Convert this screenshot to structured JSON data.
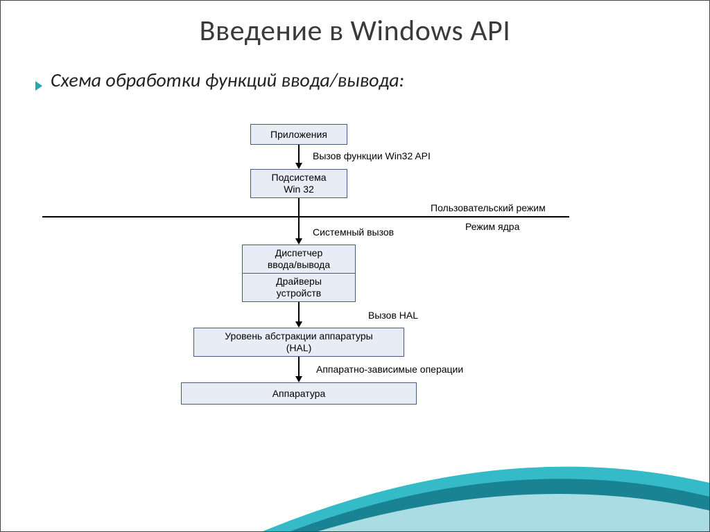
{
  "title": "Введение в Windows API",
  "subtitle": "Схема обработки функций ввода/вывода:",
  "boxes": {
    "apps": "Приложения",
    "win32": "Подсистема\nWin 32",
    "iomgr": "Диспетчер\nввода/вывода",
    "drivers": "Драйверы\nустройств",
    "hal": "Уровень абстракции аппаратуры\n(HAL)",
    "hw": "Аппаратура"
  },
  "labels": {
    "call_win32": "Вызов функции Win32 API",
    "user_mode": "Пользовательский режим",
    "kernel_mode": "Режим ядра",
    "sys_call": "Системный вызов",
    "call_hal": "Вызов HAL",
    "hw_ops": "Аппаратно-зависимые операции"
  },
  "colors": {
    "accent": "#1fa9b6",
    "box_bg": "#e8ecf5",
    "box_border": "#4a5a7a"
  }
}
